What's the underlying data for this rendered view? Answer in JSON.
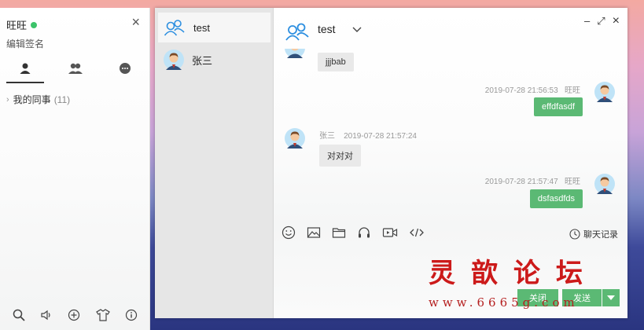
{
  "buddy_panel": {
    "user_name": "旺旺",
    "signature": "编辑签名",
    "close_glyph": "×",
    "tabs": [
      {
        "icon": "person-icon"
      },
      {
        "icon": "group-icon"
      },
      {
        "icon": "chat-bubble-icon"
      }
    ],
    "group": {
      "name": "我的同事",
      "count": "(11)"
    },
    "footer_icons": [
      "search-icon",
      "speaker-icon",
      "add-icon",
      "skin-icon",
      "info-icon"
    ]
  },
  "sessions": [
    {
      "label": "test",
      "icon": "group-icon",
      "active": true
    },
    {
      "label": "张三",
      "icon": "avatar",
      "active": false
    }
  ],
  "chat": {
    "title": "test",
    "window_controls": {
      "minimize": "–",
      "maximize": "⤢",
      "close": "×"
    },
    "messages": [
      {
        "side": "other",
        "sender": "",
        "time": "",
        "text": "jjjbab"
      },
      {
        "side": "mine",
        "sender": "旺旺",
        "time": "2019-07-28 21:56:53",
        "text": "effdfasdf"
      },
      {
        "side": "other",
        "sender": "张三",
        "time": "2019-07-28 21:57:24",
        "text": "对对对"
      },
      {
        "side": "mine",
        "sender": "旺旺",
        "time": "2019-07-28 21:57:47",
        "text": "dsfasdfds"
      }
    ],
    "toolbar_icons": [
      "emoji-icon",
      "image-icon",
      "folder-icon",
      "headset-icon",
      "video-icon",
      "code-icon"
    ],
    "history_label": "聊天记录",
    "close_button": "关闭",
    "send_button": "发送"
  },
  "watermark": {
    "title": "灵歆论坛",
    "url": "www.6665g.com"
  },
  "colors": {
    "accent": "#5bb974",
    "online": "#3cc36a",
    "icon_blue": "#2d8fe0"
  }
}
